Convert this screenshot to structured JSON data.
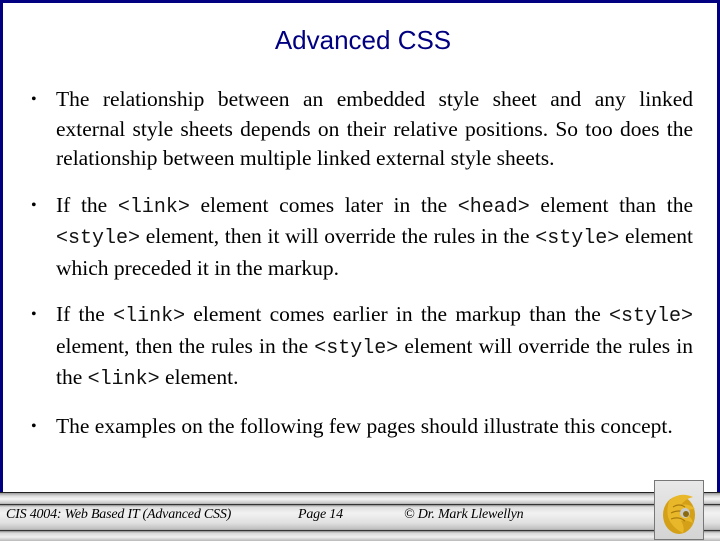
{
  "slide": {
    "title": "Advanced CSS",
    "bullets": [
      {
        "segments": [
          {
            "type": "text",
            "value": "The relationship between an embedded style sheet and any linked external style sheets depends on their relative positions.  So too does the relationship between multiple linked external style sheets."
          }
        ]
      },
      {
        "segments": [
          {
            "type": "text",
            "value": "If the "
          },
          {
            "type": "code",
            "value": "<link>"
          },
          {
            "type": "text",
            "value": " element comes later in the "
          },
          {
            "type": "code",
            "value": "<head>"
          },
          {
            "type": "text",
            "value": "  element than the "
          },
          {
            "type": "code",
            "value": "<style>"
          },
          {
            "type": "text",
            "value": "  element, then it will override the rules in the "
          },
          {
            "type": "code",
            "value": "<style>"
          },
          {
            "type": "text",
            "value": "  element which preceded it in the markup."
          }
        ]
      },
      {
        "segments": [
          {
            "type": "text",
            "value": "If the "
          },
          {
            "type": "code",
            "value": "<link>"
          },
          {
            "type": "text",
            "value": "  element comes earlier in the markup than the "
          },
          {
            "type": "code",
            "value": "<style>"
          },
          {
            "type": "text",
            "value": "  element, then the rules in the "
          },
          {
            "type": "code",
            "value": "<style>"
          },
          {
            "type": "text",
            "value": "  element will override the rules in the "
          },
          {
            "type": "code",
            "value": "<link>"
          },
          {
            "type": "text",
            "value": "  element."
          }
        ]
      },
      {
        "segments": [
          {
            "type": "text",
            "value": "The examples on the following few pages should illustrate this concept."
          }
        ]
      }
    ],
    "bullet_glyph": "•"
  },
  "footer": {
    "course": "CIS 4004: Web Based IT (Advanced CSS)",
    "page": "Page 14",
    "copyright": "© Dr. Mark Llewellyn",
    "logo_icon": "pegasus-logo-icon"
  },
  "colors": {
    "border": "#000080",
    "title": "#000080",
    "logo_gold": "#d4a017"
  }
}
